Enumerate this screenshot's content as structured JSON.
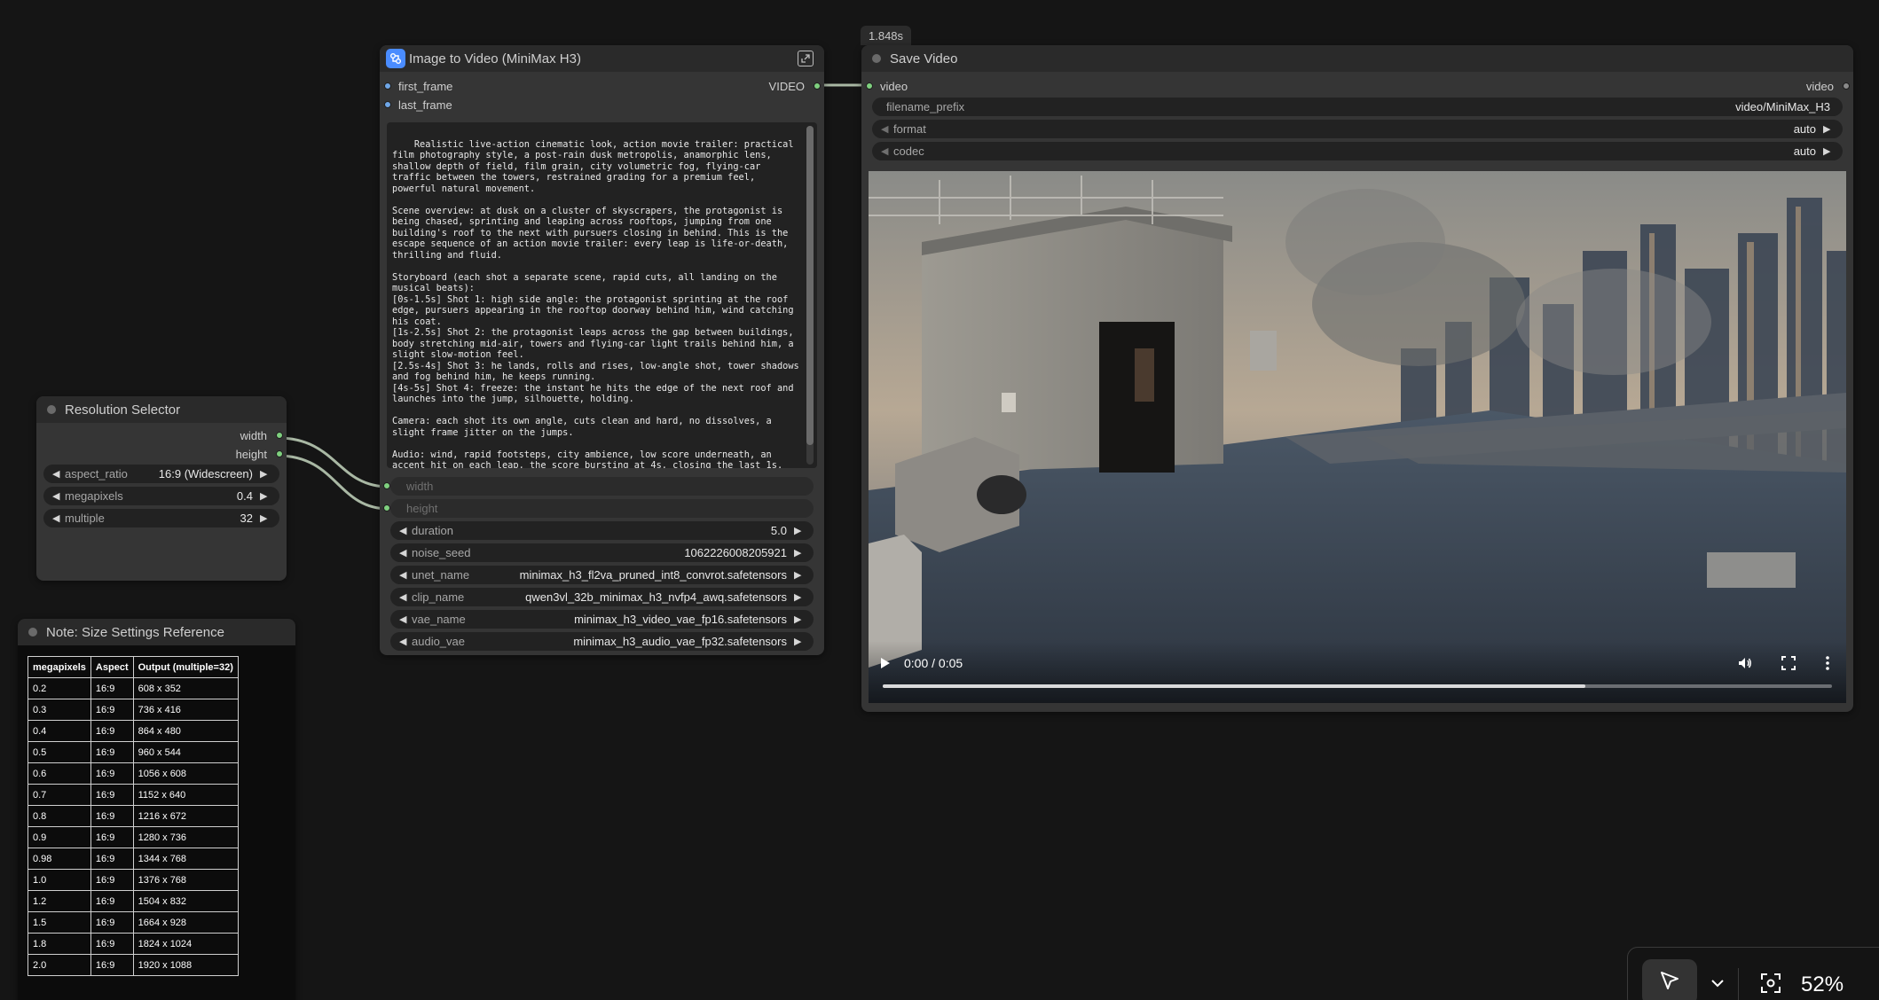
{
  "timer_badge": "1.848s",
  "resolution_selector": {
    "title": "Resolution Selector",
    "outputs": [
      "width",
      "height"
    ],
    "widgets": [
      {
        "label": "aspect_ratio",
        "value": "16:9 (Widescreen)"
      },
      {
        "label": "megapixels",
        "value": "0.4"
      },
      {
        "label": "multiple",
        "value": "32"
      }
    ]
  },
  "note": {
    "title": "Note: Size Settings Reference",
    "headers": [
      "megapixels",
      "Aspect",
      "Output (multiple=32)"
    ],
    "rows": [
      [
        "0.2",
        "16:9",
        "608 x 352"
      ],
      [
        "0.3",
        "16:9",
        "736 x 416"
      ],
      [
        "0.4",
        "16:9",
        "864 x 480"
      ],
      [
        "0.5",
        "16:9",
        "960 x 544"
      ],
      [
        "0.6",
        "16:9",
        "1056 x 608"
      ],
      [
        "0.7",
        "16:9",
        "1152 x 640"
      ],
      [
        "0.8",
        "16:9",
        "1216 x 672"
      ],
      [
        "0.9",
        "16:9",
        "1280 x 736"
      ],
      [
        "0.98",
        "16:9",
        "1344 x 768"
      ],
      [
        "1.0",
        "16:9",
        "1376 x 768"
      ],
      [
        "1.2",
        "16:9",
        "1504 x 832"
      ],
      [
        "1.5",
        "16:9",
        "1664 x 928"
      ],
      [
        "1.8",
        "16:9",
        "1824 x 1024"
      ],
      [
        "2.0",
        "16:9",
        "1920 x 1088"
      ]
    ]
  },
  "i2v": {
    "title": "Image to Video (MiniMax H3)",
    "inputs": [
      "first_frame",
      "last_frame"
    ],
    "output": "VIDEO",
    "prompt": "Realistic live-action cinematic look, action movie trailer: practical film photography style, a post-rain dusk metropolis, anamorphic lens, shallow depth of field, film grain, city volumetric fog, flying-car traffic between the towers, restrained grading for a premium feel, powerful natural movement.\n\nScene overview: at dusk on a cluster of skyscrapers, the protagonist is being chased, sprinting and leaping across rooftops, jumping from one building's roof to the next with pursuers closing in behind. This is the escape sequence of an action movie trailer: every leap is life-or-death, thrilling and fluid.\n\nStoryboard (each shot a separate scene, rapid cuts, all landing on the musical beats):\n[0s-1.5s] Shot 1: high side angle: the protagonist sprinting at the roof edge, pursuers appearing in the rooftop doorway behind him, wind catching his coat.\n[1s-2.5s] Shot 2: the protagonist leaps across the gap between buildings, body stretching mid-air, towers and flying-car light trails behind him, a slight slow-motion feel.\n[2.5s-4s] Shot 3: he lands, rolls and rises, low-angle shot, tower shadows and fog behind him, he keeps running.\n[4s-5s] Shot 4: freeze: the instant he hits the edge of the next roof and launches into the jump, silhouette, holding.\n\nCamera: each shot its own angle, cuts clean and hard, no dissolves, a slight frame jitter on the jumps.\n\nAudio: wind, rapid footsteps, city ambience, low score underneath, an accent hit on each leap, the score bursting at 4s, closing the last 1s.",
    "linked_inputs": [
      "width",
      "height"
    ],
    "widgets": [
      {
        "label": "duration",
        "value": "5.0"
      },
      {
        "label": "noise_seed",
        "value": "1062226008205921"
      },
      {
        "label": "unet_name",
        "value": "minimax_h3_fl2va_pruned_int8_convrot.safetensors"
      },
      {
        "label": "clip_name",
        "value": "qwen3vl_32b_minimax_h3_nvfp4_awq.safetensors"
      },
      {
        "label": "vae_name",
        "value": "minimax_h3_video_vae_fp16.safetensors"
      },
      {
        "label": "audio_vae",
        "value": "minimax_h3_audio_vae_fp32.safetensors"
      }
    ]
  },
  "save_video": {
    "title": "Save Video",
    "input": "video",
    "output": "video",
    "widgets": [
      {
        "label": "filename_prefix",
        "value": "video/MiniMax_H3"
      },
      {
        "label": "format",
        "value": "auto"
      },
      {
        "label": "codec",
        "value": "auto"
      }
    ],
    "player": {
      "time": "0:00 / 0:05",
      "progress": 0.74
    }
  },
  "toolbar": {
    "zoom": "52%"
  },
  "icons": [
    "node-icon",
    "expand-icon",
    "play-icon",
    "volume-icon",
    "fullscreen-icon",
    "more-icon",
    "pointer-icon",
    "chevron-down-icon",
    "fit-view-icon"
  ]
}
